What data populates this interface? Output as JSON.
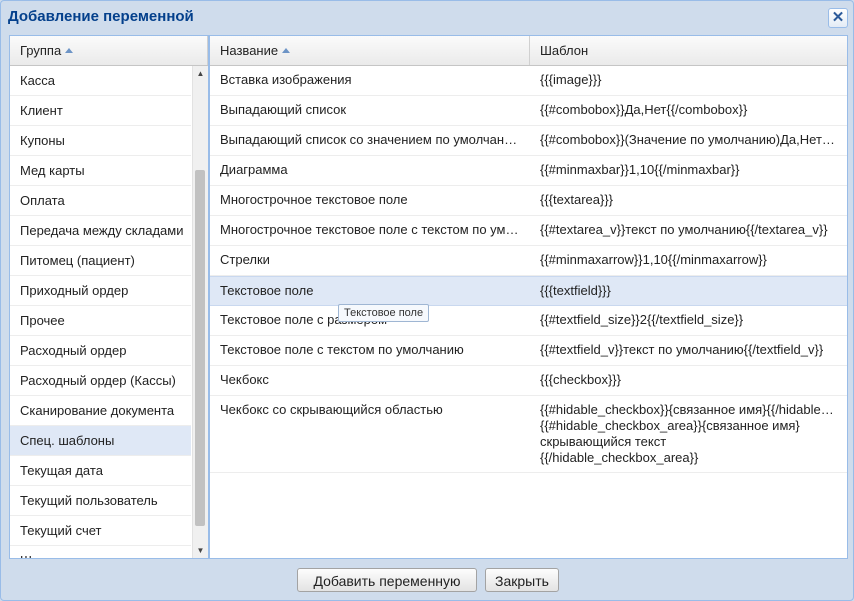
{
  "dialog": {
    "title": "Добавление переменной",
    "close_icon": "✕"
  },
  "groups": {
    "header": "Группа",
    "items": [
      {
        "label": "Касса"
      },
      {
        "label": "Клиент"
      },
      {
        "label": "Купоны"
      },
      {
        "label": "Мед карты"
      },
      {
        "label": "Оплата"
      },
      {
        "label": "Передача между складами"
      },
      {
        "label": "Питомец (пациент)"
      },
      {
        "label": "Приходный ордер"
      },
      {
        "label": "Прочее"
      },
      {
        "label": "Расходный ордер"
      },
      {
        "label": "Расходный ордер (Кассы)"
      },
      {
        "label": "Сканирование документа"
      },
      {
        "label": "Спец. шаблоны"
      },
      {
        "label": "Текущая дата"
      },
      {
        "label": "Текущий пользователь"
      },
      {
        "label": "Текущий счет"
      },
      {
        "label": "Штрихкоды"
      }
    ],
    "selected_index": 12
  },
  "variables": {
    "header_name": "Название",
    "header_template": "Шаблон",
    "rows": [
      {
        "name": "Вставка изображения",
        "template": "{{{image}}}"
      },
      {
        "name": "Выпадающий список",
        "template": "{{#combobox}}Да,Нет{{/combobox}}"
      },
      {
        "name": "Выпадающий список со значением по умолчанию",
        "template": "{{#combobox}}(Значение по умолчанию)Да,Нет{{/combobox}}"
      },
      {
        "name": "Диаграмма",
        "template": "{{#minmaxbar}}1,10{{/minmaxbar}}"
      },
      {
        "name": "Многострочное текстовое поле",
        "template": "{{{textarea}}}"
      },
      {
        "name": "Многострочное текстовое поле с текстом по умолчанию",
        "template": "{{#textarea_v}}текст по умолчанию{{/textarea_v}}"
      },
      {
        "name": "Стрелки",
        "template": "{{#minmaxarrow}}1,10{{/minmaxarrow}}"
      },
      {
        "name": "Текстовое поле",
        "template": "{{{textfield}}}"
      },
      {
        "name": "Текстовое поле с размером",
        "template": "{{#textfield_size}}2{{/textfield_size}}"
      },
      {
        "name": "Текстовое поле с текстом по умолчанию",
        "template": "{{#textfield_v}}текст по умолчанию{{/textfield_v}}"
      },
      {
        "name": "Чекбокс",
        "template": "{{{checkbox}}}"
      },
      {
        "name": "Чекбокс со скрывающийся областью",
        "template_lines": [
          "{{#hidable_checkbox}}{связанное имя}{{/hidable_checkbox}}",
          "{{#hidable_checkbox_area}}{связанное имя}",
          "скрывающийся текст",
          "{{/hidable_checkbox_area}}"
        ]
      }
    ],
    "highlighted_index": 7,
    "tooltip": "Текстовое поле"
  },
  "buttons": {
    "add": "Добавить переменную",
    "close": "Закрыть"
  },
  "colors": {
    "window_bg": "#cfdcec",
    "title": "#04408c",
    "selection": "#dfe8f6"
  }
}
